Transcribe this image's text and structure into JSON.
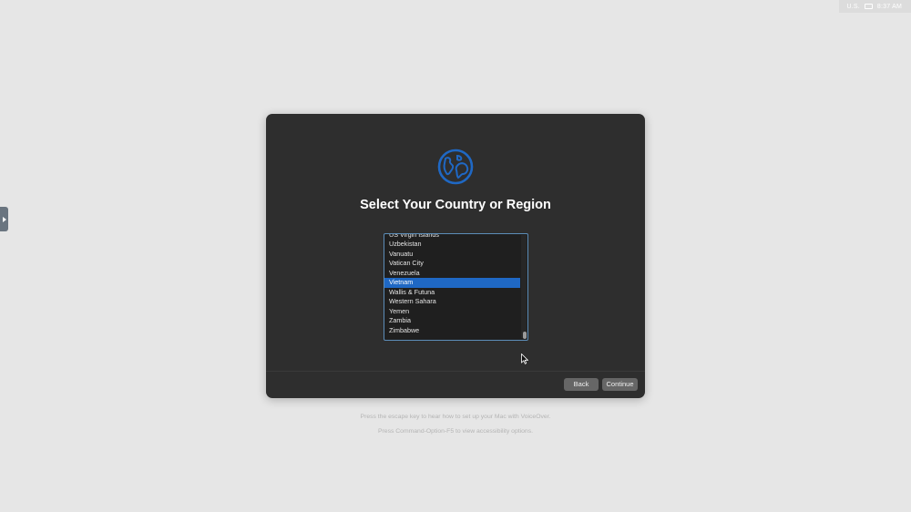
{
  "menubar": {
    "input_source": "U.S.",
    "keyboard_icon": "keyboard-icon",
    "time": "8:37 AM"
  },
  "side_tab": {
    "icon": "chevron-right-icon"
  },
  "dialog": {
    "icon": "globe-icon",
    "accent_color": "#1f68c4",
    "title": "Select Your Country or Region",
    "countries": [
      "US Virgin Islands",
      "Uzbekistan",
      "Vanuatu",
      "Vatican City",
      "Venezuela",
      "Vietnam",
      "Wallis & Futuna",
      "Western Sahara",
      "Yemen",
      "Zambia",
      "Zimbabwe"
    ],
    "selected": "Vietnam",
    "back_label": "Back",
    "continue_label": "Continue"
  },
  "hints": {
    "voiceover": "Press the escape key to hear how to set up your Mac with VoiceOver.",
    "accessibility": "Press Command-Option-F5 to view accessibility options."
  }
}
